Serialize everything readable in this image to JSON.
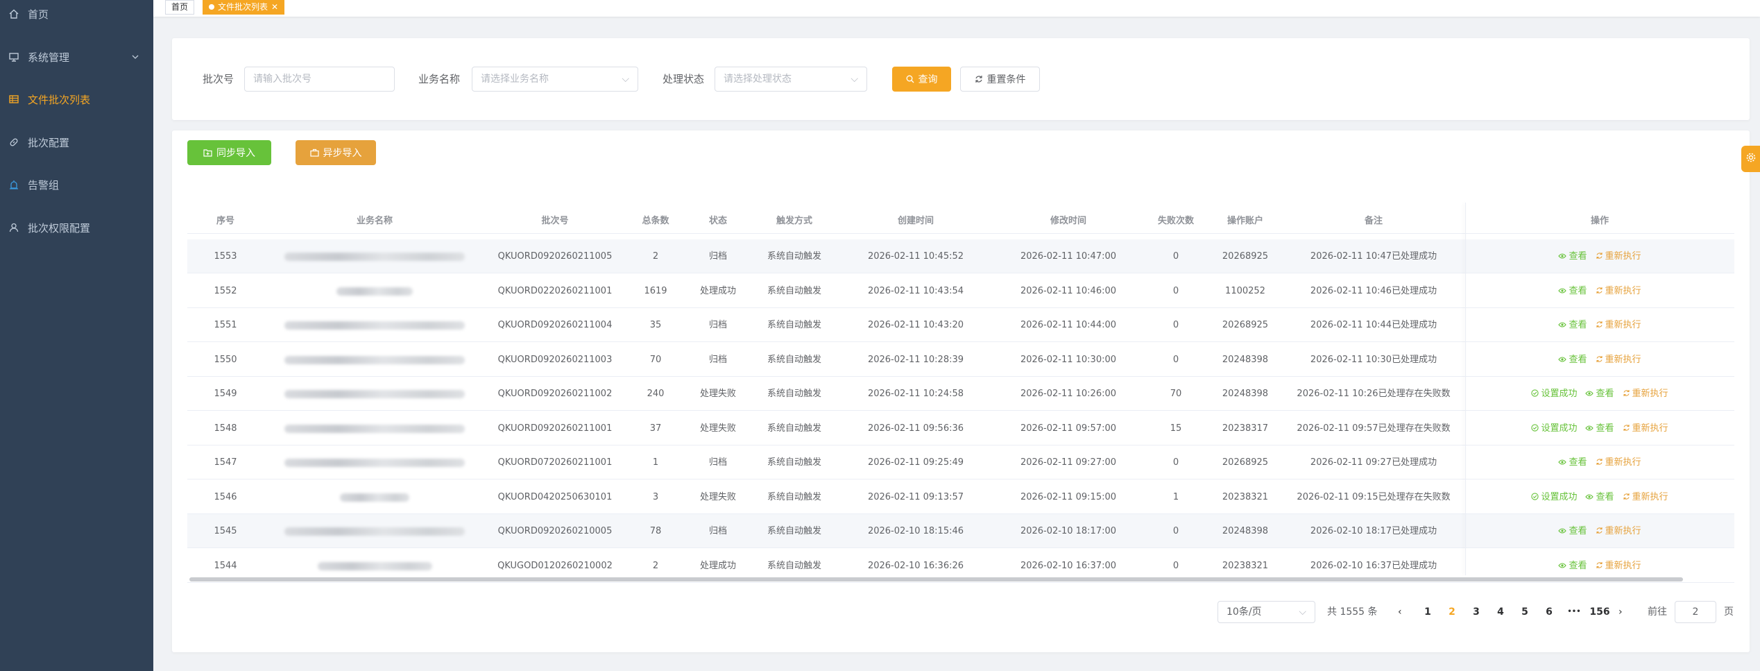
{
  "sidebar": {
    "items": [
      {
        "label": "首页",
        "icon": "home-icon"
      },
      {
        "label": "系统管理",
        "icon": "monitor-icon"
      },
      {
        "label": "文件批次列表",
        "icon": "table-icon"
      },
      {
        "label": "批次配置",
        "icon": "link-icon"
      },
      {
        "label": "告警组",
        "icon": "alarm-icon"
      },
      {
        "label": "批次权限配置",
        "icon": "user-icon"
      }
    ]
  },
  "tags": {
    "home": "首页",
    "current": "文件批次列表"
  },
  "filters": {
    "batch_label": "批次号",
    "batch_placeholder": "请输入批次号",
    "business_label": "业务名称",
    "business_placeholder": "请选择业务名称",
    "status_label": "处理状态",
    "status_placeholder": "请选择处理状态",
    "query_button": "查询",
    "reset_button": "重置条件"
  },
  "actions": {
    "sync_import": "同步导入",
    "async_import": "异步导入"
  },
  "table": {
    "headers": [
      "序号",
      "业务名称",
      "批次号",
      "总条数",
      "状态",
      "触发方式",
      "创建时间",
      "修改时间",
      "失败次数",
      "操作账户",
      "备注",
      "操作"
    ],
    "op_labels": {
      "set_success": "设置成功",
      "view": "查看",
      "rerun": "重新执行"
    },
    "rows": [
      {
        "id": "1553",
        "blur_w": 260,
        "name_prefix": "",
        "batch": "QKUORD0920260211005",
        "total": "2",
        "status": "归档",
        "trigger": "系统自动触发",
        "created": "2026-02-11 10:45:52",
        "modified": "2026-02-11 10:47:00",
        "fails": "0",
        "account": "20268925",
        "remark": "2026-02-11 10:47已处理成功",
        "ops": [
          "view",
          "rerun"
        ]
      },
      {
        "id": "1552",
        "blur_w": 110,
        "name_prefix": "",
        "batch": "QKUORD0220260211001",
        "total": "1619",
        "status": "处理成功",
        "trigger": "系统自动触发",
        "created": "2026-02-11 10:43:54",
        "modified": "2026-02-11 10:46:00",
        "fails": "0",
        "account": "1100252",
        "remark": "2026-02-11 10:46已处理成功",
        "ops": [
          "view",
          "rerun"
        ]
      },
      {
        "id": "1551",
        "blur_w": 260,
        "name_prefix": "",
        "batch": "QKUORD0920260211004",
        "total": "35",
        "status": "归档",
        "trigger": "系统自动触发",
        "created": "2026-02-11 10:43:20",
        "modified": "2026-02-11 10:44:00",
        "fails": "0",
        "account": "20268925",
        "remark": "2026-02-11 10:44已处理成功",
        "ops": [
          "view",
          "rerun"
        ]
      },
      {
        "id": "1550",
        "blur_w": 260,
        "name_prefix": "",
        "batch": "QKUORD0920260211003",
        "total": "70",
        "status": "归档",
        "trigger": "系统自动触发",
        "created": "2026-02-11 10:28:39",
        "modified": "2026-02-11 10:30:00",
        "fails": "0",
        "account": "20248398",
        "remark": "2026-02-11 10:30已处理成功",
        "ops": [
          "view",
          "rerun"
        ]
      },
      {
        "id": "1549",
        "blur_w": 260,
        "name_prefix": "",
        "batch": "QKUORD0920260211002",
        "total": "240",
        "status": "处理失败",
        "trigger": "系统自动触发",
        "created": "2026-02-11 10:24:58",
        "modified": "2026-02-11 10:26:00",
        "fails": "70",
        "account": "20248398",
        "remark": "2026-02-11 10:26已处理存在失败数",
        "ops": [
          "set_success",
          "view",
          "rerun"
        ]
      },
      {
        "id": "1548",
        "blur_w": 260,
        "name_prefix": "",
        "batch": "QKUORD0920260211001",
        "total": "37",
        "status": "处理失败",
        "trigger": "系统自动触发",
        "created": "2026-02-11 09:56:36",
        "modified": "2026-02-11 09:57:00",
        "fails": "15",
        "account": "20238317",
        "remark": "2026-02-11 09:57已处理存在失败数",
        "ops": [
          "set_success",
          "view",
          "rerun"
        ]
      },
      {
        "id": "1547",
        "blur_w": 260,
        "name_prefix": "",
        "batch": "QKUORD0720260211001",
        "total": "1",
        "status": "归档",
        "trigger": "系统自动触发",
        "created": "2026-02-11 09:25:49",
        "modified": "2026-02-11 09:27:00",
        "fails": "0",
        "account": "20268925",
        "remark": "2026-02-11 09:27已处理成功",
        "ops": [
          "view",
          "rerun"
        ]
      },
      {
        "id": "1546",
        "blur_w": 100,
        "name_prefix": "",
        "batch": "QKUORD0420250630101",
        "total": "3",
        "status": "处理失败",
        "trigger": "系统自动触发",
        "created": "2026-02-11 09:13:57",
        "modified": "2026-02-11 09:15:00",
        "fails": "1",
        "account": "20238321",
        "remark": "2026-02-11 09:15已处理存在失败数",
        "ops": [
          "set_success",
          "view",
          "rerun"
        ]
      },
      {
        "id": "1545",
        "blur_w": 260,
        "name_prefix": "",
        "batch": "QKUORD0920260210005",
        "total": "78",
        "status": "归档",
        "trigger": "系统自动触发",
        "created": "2026-02-10 18:15:46",
        "modified": "2026-02-10 18:17:00",
        "fails": "0",
        "account": "20248398",
        "remark": "2026-02-10 18:17已处理成功",
        "ops": [
          "view",
          "rerun"
        ]
      },
      {
        "id": "1544",
        "blur_w": 165,
        "name_prefix": "",
        "batch": "QKUGOD0120260210002",
        "total": "2",
        "status": "处理成功",
        "trigger": "系统自动触发",
        "created": "2026-02-10 16:36:26",
        "modified": "2026-02-10 16:37:00",
        "fails": "0",
        "account": "20238321",
        "remark": "2026-02-10 16:37已处理成功",
        "ops": [
          "view",
          "rerun"
        ]
      }
    ]
  },
  "pagination": {
    "page_size": "10条/页",
    "total": "共 1555 条",
    "pages": [
      "1",
      "2",
      "3",
      "4",
      "5",
      "6"
    ],
    "current": "2",
    "ellipsis": "•••",
    "last": "156",
    "goto_label": "前往",
    "goto_value": "2",
    "page_suffix": "页"
  },
  "colors": {
    "accent": "#f5a623",
    "success": "#67c23a",
    "sidebar_bg": "#304156"
  }
}
